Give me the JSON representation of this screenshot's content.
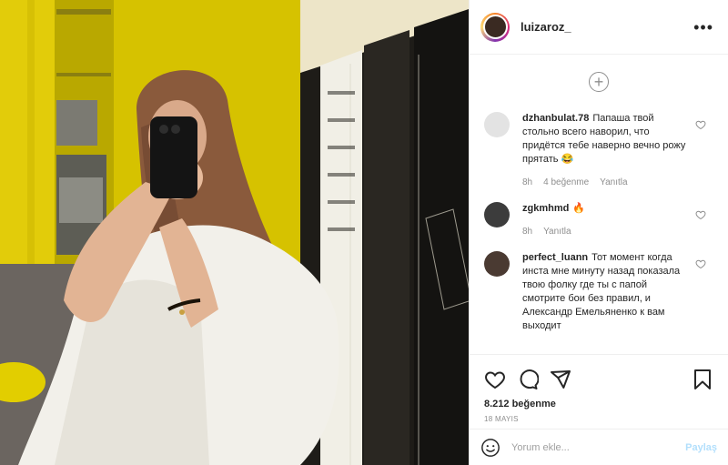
{
  "post": {
    "author": "luizaroz_",
    "likes": "8.212 beğenme",
    "date": "18 MAYIS"
  },
  "comments": [
    {
      "user": "dzhanbulat.78",
      "text": "Папаша твой стольно всего наворил, что придётся тебе наверно вечно рожу прятать 😂",
      "time": "8h",
      "likes": "4 beğenme",
      "reply": "Yanıtla",
      "avatar_color": "#e3e3e3"
    },
    {
      "user": "zgkmhmd",
      "text": "🔥",
      "time": "8h",
      "reply": "Yanıtla",
      "avatar_color": "#3c3c3c"
    },
    {
      "user": "perfect_luann",
      "text": "Тот момент когда инста мне минуту назад показала твою фолку где ты с папой смотрите бои без правил, и Александр Емельяненко к вам выходит",
      "avatar_color": "#4a3a32"
    }
  ],
  "add_comment": {
    "placeholder": "Yorum ekle...",
    "post_label": "Paylaş"
  },
  "icons": {
    "more": "more-dots-icon",
    "load_more": "plus-circle-icon",
    "like": "heart-icon",
    "comment": "comment-icon",
    "share": "share-icon",
    "save": "bookmark-icon",
    "emoji": "emoji-icon"
  },
  "colors": {
    "wall_yellow": "#d8c400",
    "link_blue": "#b2dffc",
    "muted_text": "#8e8e8e"
  }
}
